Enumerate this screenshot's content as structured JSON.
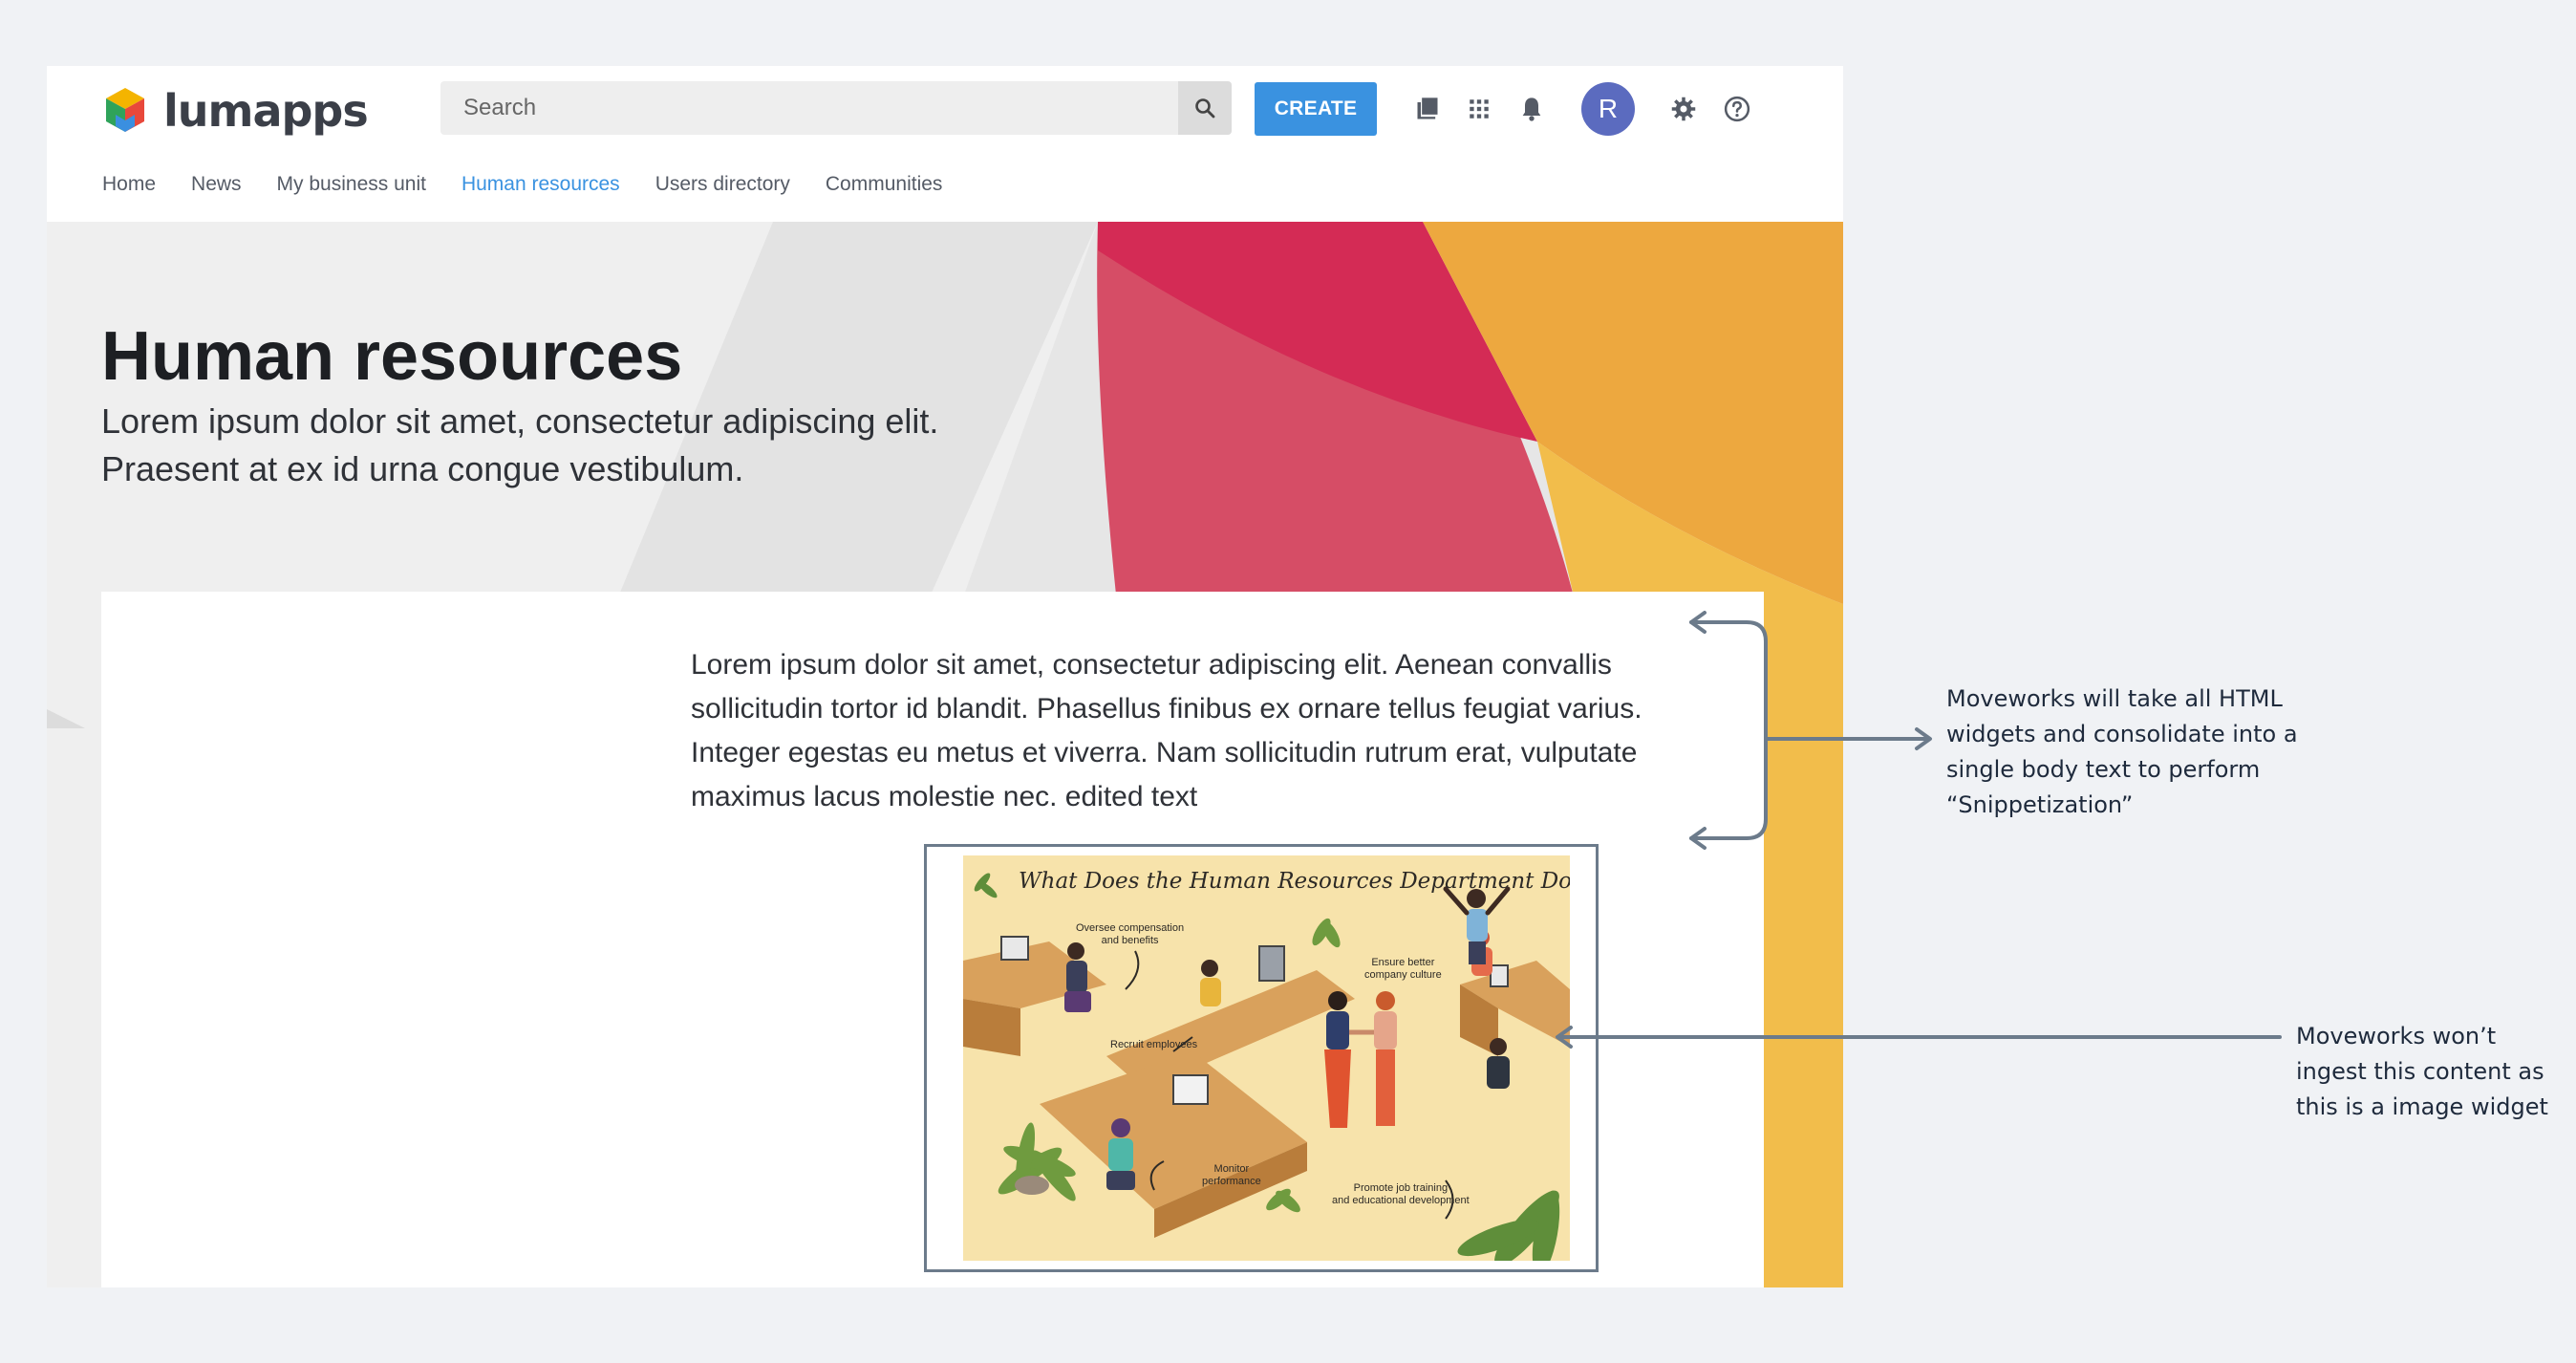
{
  "header": {
    "logo_text": "lumapps",
    "search_placeholder": "Search",
    "create_label": "CREATE",
    "avatar_initial": "R",
    "accent_color": "#3a92e0"
  },
  "nav": {
    "items": [
      "Home",
      "News",
      "My business unit",
      "Human resources",
      "Users directory",
      "Communities"
    ],
    "active": "Human resources"
  },
  "hero": {
    "title": "Human resources",
    "subtitle_line1": "Lorem ipsum dolor sit amet, consectetur adipiscing elit.",
    "subtitle_line2": "Praesent at ex id urna congue vestibulum."
  },
  "content": {
    "body_text": "Lorem ipsum dolor sit amet, consectetur adipiscing elit. Aenean convallis sollicitudin tortor id blandit. Phasellus finibus ex ornare tellus feugiat varius. Integer egestas eu metus et viverra. Nam sollicitudin rutrum erat, vulputate maximus lacus molestie nec. edited text",
    "image": {
      "title": "What Does the Human Resources Department Do?",
      "labels": {
        "compensation": "Oversee compensation\nand benefits",
        "culture": "Ensure better\ncompany culture",
        "recruit": "Recruit employees",
        "monitor": "Monitor\nperformance",
        "training": "Promote job training\nand educational development"
      }
    }
  },
  "annotations": {
    "html_widgets": [
      "Moveworks will take all HTML",
      "widgets and consolidate into a",
      "single body text to perform",
      "“Snippetization”"
    ],
    "image_widget": [
      "Moveworks won’t",
      "ingest this content as",
      "this is a image widget"
    ]
  },
  "icons": {
    "search": "search-icon",
    "library": "library-icon",
    "apps": "apps-grid-icon",
    "notifications": "bell-icon",
    "settings": "gear-icon",
    "help": "help-icon"
  }
}
